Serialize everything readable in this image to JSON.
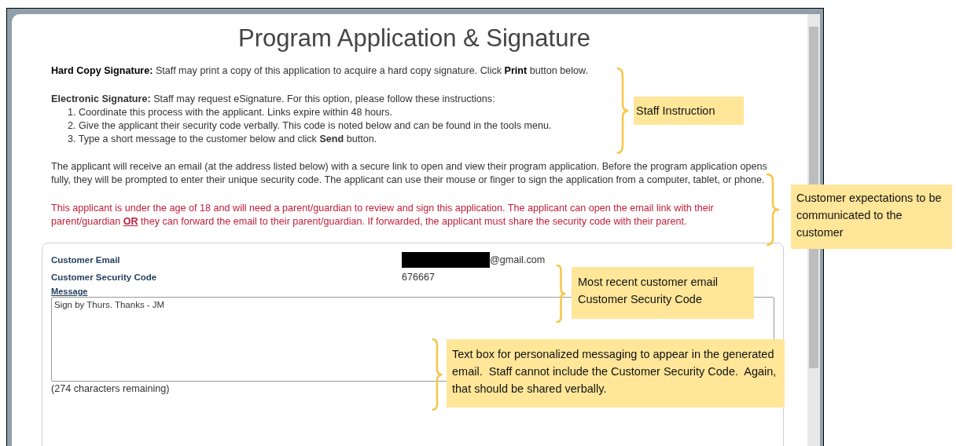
{
  "dialog": {
    "title": "Program Application & Signature",
    "hard_copy": "**Hard Copy Signature:** Staff may print a copy of this application to acquire a hard copy signature. Click **Print** button below.",
    "electronic": "**Electronic Signature:** Staff may request eSignature. For this option, please follow these instructions:",
    "steps": [
      "1. Coordinate this process with the applicant. Links expire within 48 hours.",
      "2. Give the applicant their security code verbally. This code is noted below and can be found in the tools menu.",
      "3. Type a short message to the customer below and click **Send** button."
    ],
    "info": "The applicant will receive an email (at the address listed below) with a secure link to open and view their program application. Before the program application opens fully, they will be prompted to enter their unique security code. The applicant can use their mouse or finger to sign the application from a computer, tablet, or phone.",
    "warning": "This applicant is under the age of 18 and will need a parent/guardian to review and sign this application. The applicant can open the email link with their parent/guardian **OR** they can forward the email to their parent/guardian. If forwarded, the applicant must share the security code with their parent.",
    "fields": [
      {
        "label": "Customer Email",
        "value": "@gmail.com",
        "redacted": true
      },
      {
        "label": "Customer Security Code",
        "value": "676667",
        "redacted": false
      }
    ],
    "message": {
      "label": "Message",
      "value": "Sign by Thurs. Thanks - JM",
      "remaining": "(274 characters remaining)"
    }
  },
  "annotations": [
    {
      "text": "Staff Instruction"
    },
    {
      "text": "Customer expectations to be communicated to the customer"
    },
    {
      "text": "Most recent customer email Customer Security Code"
    },
    {
      "text": "Text box for personalized messaging to appear in the generated email.  Staff cannot include the Customer Security Code.  Again, that should be shared verbally."
    }
  ]
}
